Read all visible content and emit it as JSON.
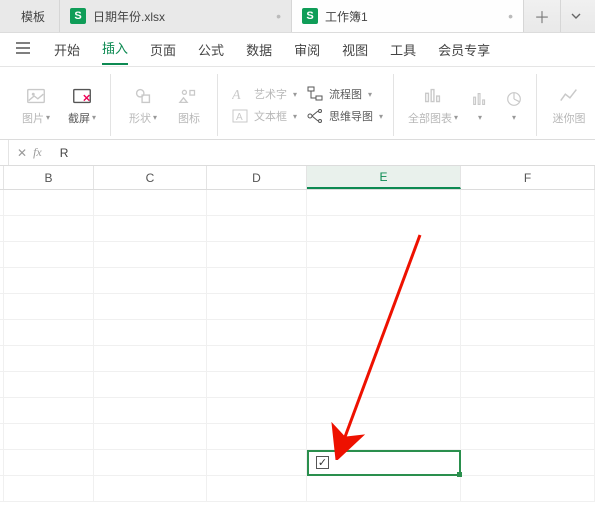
{
  "tabs": {
    "first_label": "模板",
    "file1": "日期年份.xlsx",
    "file2": "工作簿1"
  },
  "menu": {
    "start": "开始",
    "insert": "插入",
    "page": "页面",
    "formula": "公式",
    "data": "数据",
    "review": "审阅",
    "view": "视图",
    "tools": "工具",
    "member": "会员专享"
  },
  "ribbon": {
    "picture": "图片",
    "screenshot": "截屏",
    "shapes": "形状",
    "icons": "图标",
    "wordart": "艺术字",
    "textbox": "文本框",
    "flowchart": "流程图",
    "mindmap": "思维导图",
    "allcharts": "全部图表",
    "mini": "迷你图"
  },
  "formula_bar": {
    "value": "R"
  },
  "columns": {
    "B": "B",
    "C": "C",
    "D": "D",
    "E": "E",
    "F": "F"
  },
  "active_cell": {
    "row": 10,
    "col": "E",
    "checkbox_checked": true
  }
}
